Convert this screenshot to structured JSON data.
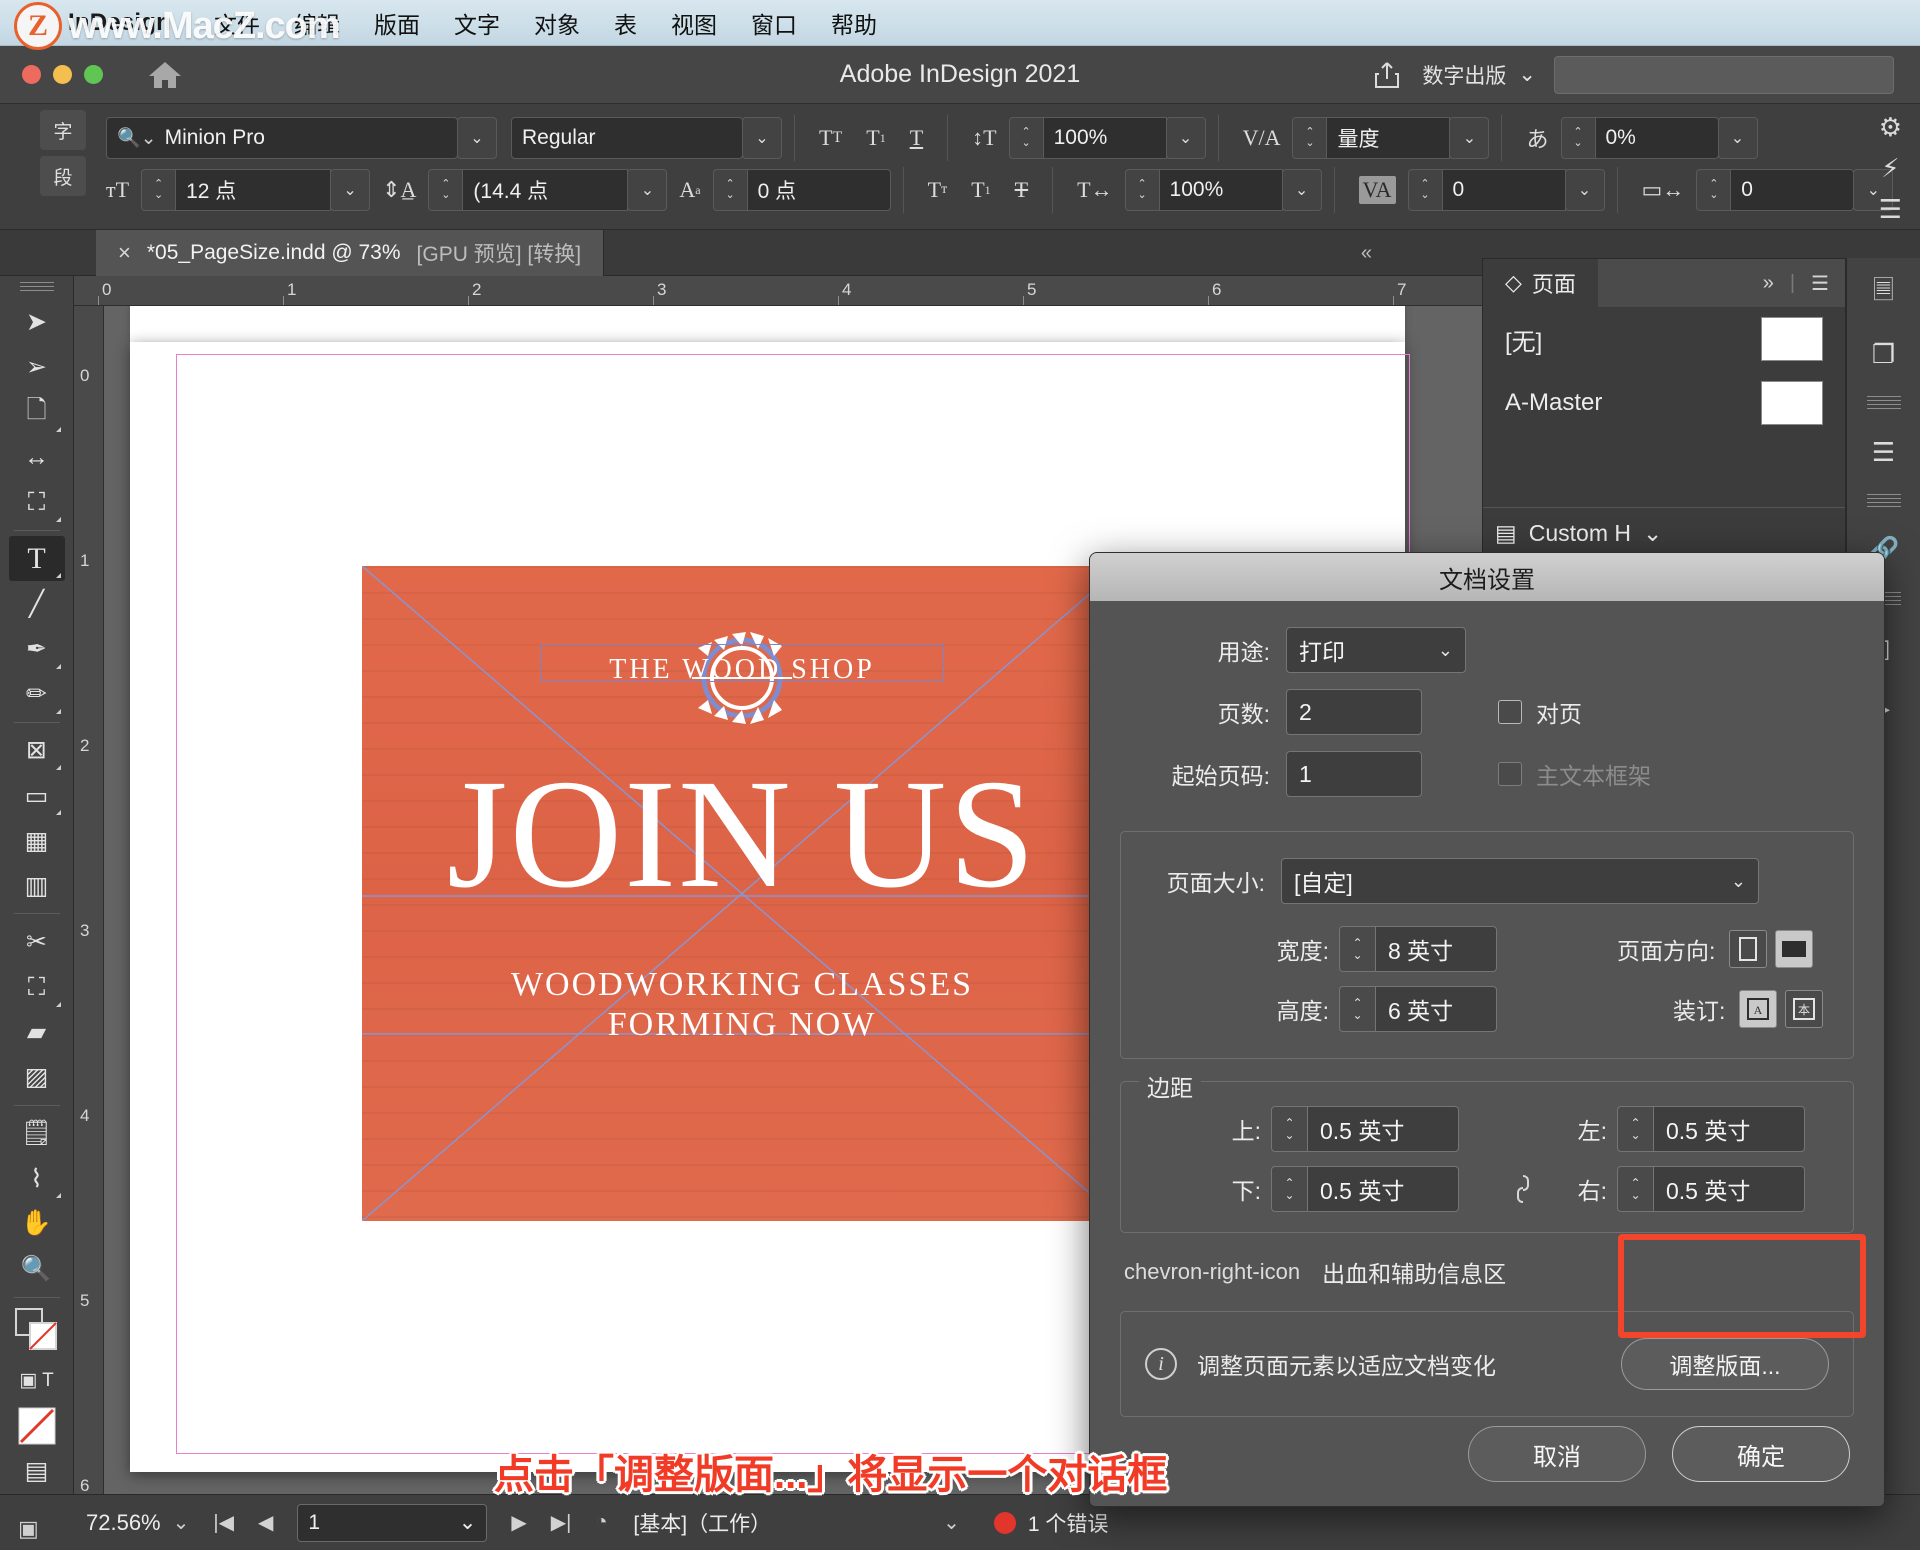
{
  "menubar": {
    "app_name": "InDesign",
    "items": [
      "文件",
      "编辑",
      "版面",
      "文字",
      "对象",
      "表",
      "视图",
      "窗口",
      "帮助"
    ],
    "watermark": "www.MacZ.com",
    "watermark_badge": "Z"
  },
  "titlebar": {
    "title": "Adobe InDesign 2021",
    "workspace": "数字出版",
    "home_icon": "home-icon",
    "share_icon": "share-icon",
    "search_placeholder": ""
  },
  "control_panel": {
    "mode_char": "字",
    "mode_para": "段",
    "font_family": "Minion Pro",
    "font_style": "Regular",
    "font_size": "12 点",
    "leading": "(14.4 点",
    "baseline_shift": "0 点",
    "vertical_scale": "100%",
    "horizontal_scale": "100%",
    "kerning": "量度",
    "tracking": "0",
    "tsume": "0%",
    "char_spacing": "0",
    "icons": {
      "all_caps": "TT",
      "superscript": "T¹",
      "underline": "T_",
      "small_caps": "Tᴛ",
      "subscript": "T₁",
      "strikethrough": "T-strike",
      "vscale": "vertical-scale-icon",
      "hscale": "horizontal-scale-icon",
      "kerning": "kerning-icon",
      "tracking": "tracking-icon",
      "tsume": "tsume-icon",
      "char_spacing": "char-spacing-icon"
    }
  },
  "document_tab": {
    "close": "×",
    "name": "*05_PageSize.indd @ 73%",
    "flags": "[GPU 预览] [转换]"
  },
  "rulers": {
    "horizontal_ticks": [
      "0",
      "1",
      "2",
      "3",
      "4",
      "5",
      "6",
      "7"
    ],
    "vertical_ticks": [
      "0",
      "1",
      "2",
      "3",
      "4",
      "5",
      "6"
    ]
  },
  "toolbox": {
    "tools": [
      {
        "name": "selection-tool",
        "glyph": "➤"
      },
      {
        "name": "direct-selection-tool",
        "glyph": "➤"
      },
      {
        "name": "page-tool",
        "glyph": "▣"
      },
      {
        "name": "gap-tool",
        "glyph": "↔"
      },
      {
        "name": "content-collector-tool",
        "glyph": "▤"
      },
      {
        "name": "type-tool",
        "glyph": "T",
        "selected": true
      },
      {
        "name": "line-tool",
        "glyph": "╱"
      },
      {
        "name": "pen-tool",
        "glyph": "✒"
      },
      {
        "name": "pencil-tool",
        "glyph": "✏"
      },
      {
        "name": "frame-tool",
        "glyph": "⊠"
      },
      {
        "name": "rectangle-tool",
        "glyph": "▭"
      },
      {
        "name": "table-tool",
        "glyph": "▦"
      },
      {
        "name": "column-tool",
        "glyph": "▥"
      },
      {
        "name": "scissors-tool",
        "glyph": "✂"
      },
      {
        "name": "free-transform-tool",
        "glyph": "⛶"
      },
      {
        "name": "gradient-swatch-tool",
        "glyph": "▰"
      },
      {
        "name": "gradient-feather-tool",
        "glyph": "▨"
      },
      {
        "name": "note-tool",
        "glyph": "▤"
      },
      {
        "name": "eyedropper-tool",
        "glyph": "⌇"
      },
      {
        "name": "hand-tool",
        "glyph": "✋"
      },
      {
        "name": "zoom-tool",
        "glyph": "🔍"
      }
    ]
  },
  "artwork": {
    "shop_name": "THE WOOD SHOP",
    "headline": "JOIN US",
    "sub1": "WOODWORKING CLASSES",
    "sub2": "FORMING NOW",
    "bg_color": "#df6447"
  },
  "pages_panel": {
    "tab_label": "页面",
    "collapse_icon": "chevron-double-right-icon",
    "menu_icon": "panel-menu-icon",
    "masters": [
      {
        "label": "[无]"
      },
      {
        "label": "A-Master"
      }
    ],
    "footer_label": "Custom H",
    "footer_caret": "chevron-down-icon"
  },
  "dialog": {
    "title": "文档设置",
    "intent_label": "用途:",
    "intent_value": "打印",
    "pages_label": "页数:",
    "pages_value": "2",
    "facing_pages_label": "对页",
    "start_page_label": "起始页码:",
    "start_page_value": "1",
    "master_frame_label": "主文本框架",
    "page_size_label": "页面大小:",
    "page_size_value": "[自定]",
    "width_label": "宽度:",
    "width_value": "8 英寸",
    "height_label": "高度:",
    "height_value": "6 英寸",
    "orientation_label": "页面方向:",
    "binding_label": "装订:",
    "margins_legend": "边距",
    "margin_top_label": "上:",
    "margin_top_value": "0.5 英寸",
    "margin_bottom_label": "下:",
    "margin_bottom_value": "0.5 英寸",
    "margin_left_label": "左:",
    "margin_left_value": "0.5 英寸",
    "margin_right_label": "右:",
    "margin_right_value": "0.5 英寸",
    "link_icon": "broken-link-icon",
    "bleed_section_label": "出血和辅助信息区",
    "bleed_arrow": "chevron-right-icon",
    "adjust_info_text": "调整页面元素以适应文档变化",
    "adjust_button_label": "调整版面...",
    "cancel_label": "取消",
    "ok_label": "确定",
    "highlight_color": "#f2452c"
  },
  "annotation": {
    "text": "点击「调整版面...」将显示一个对话框",
    "color": "#f13b26"
  },
  "statusbar": {
    "zoom": "72.56%",
    "page_value": "1",
    "workspace": "[基本]（工作）",
    "error_text": "1 个错误",
    "error_color": "#e2352b",
    "first_icon": "first-page-icon",
    "prev_icon": "prev-page-icon",
    "next_icon": "next-page-icon",
    "last_icon": "last-page-icon",
    "preflight_icon": "preflight-icon"
  }
}
